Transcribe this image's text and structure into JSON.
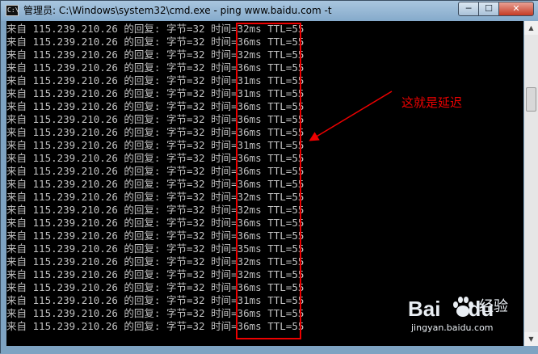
{
  "window": {
    "title": "管理员: C:\\Windows\\system32\\cmd.exe - ping  www.baidu.com -t",
    "icon_text": "C:\\",
    "controls": [
      "minimize-icon",
      "maximize-icon",
      "close-icon"
    ],
    "control_glyphs": {
      "minimize": "─",
      "maximize": "☐",
      "close": "✕"
    }
  },
  "console": {
    "lines": [
      "来自 115.239.210.26 的回复: 字节=32 时间=32ms TTL=55",
      "来自 115.239.210.26 的回复: 字节=32 时间=36ms TTL=55",
      "来自 115.239.210.26 的回复: 字节=32 时间=32ms TTL=55",
      "来自 115.239.210.26 的回复: 字节=32 时间=36ms TTL=55",
      "来自 115.239.210.26 的回复: 字节=32 时间=31ms TTL=55",
      "来自 115.239.210.26 的回复: 字节=32 时间=31ms TTL=55",
      "来自 115.239.210.26 的回复: 字节=32 时间=36ms TTL=55",
      "来自 115.239.210.26 的回复: 字节=32 时间=36ms TTL=55",
      "来自 115.239.210.26 的回复: 字节=32 时间=36ms TTL=55",
      "来自 115.239.210.26 的回复: 字节=32 时间=31ms TTL=55",
      "来自 115.239.210.26 的回复: 字节=32 时间=36ms TTL=55",
      "来自 115.239.210.26 的回复: 字节=32 时间=36ms TTL=55",
      "来自 115.239.210.26 的回复: 字节=32 时间=36ms TTL=55",
      "来自 115.239.210.26 的回复: 字节=32 时间=32ms TTL=55",
      "来自 115.239.210.26 的回复: 字节=32 时间=32ms TTL=55",
      "来自 115.239.210.26 的回复: 字节=32 时间=36ms TTL=55",
      "来自 115.239.210.26 的回复: 字节=32 时间=36ms TTL=55",
      "来自 115.239.210.26 的回复: 字节=32 时间=35ms TTL=55",
      "来自 115.239.210.26 的回复: 字节=32 时间=32ms TTL=55",
      "来自 115.239.210.26 的回复: 字节=32 时间=32ms TTL=55",
      "来自 115.239.210.26 的回复: 字节=32 时间=36ms TTL=55",
      "来自 115.239.210.26 的回复: 字节=32 时间=31ms TTL=55",
      "来自 115.239.210.26 的回复: 字节=32 时间=36ms TTL=55",
      "来自 115.239.210.26 的回复: 字节=32 时间=36ms TTL=55"
    ]
  },
  "annotation": {
    "text": "这就是延迟",
    "color": "#e00000"
  },
  "scrollbar": {
    "up_glyph": "▲",
    "down_glyph": "▼"
  },
  "watermark": {
    "brand": "Bai",
    "brand_suffix": "du",
    "product": "经验",
    "url": "jingyan.baidu.com"
  },
  "colors": {
    "console_bg": "#000000",
    "console_text": "#c0c0c0",
    "titlebar": "#96b8d6"
  }
}
